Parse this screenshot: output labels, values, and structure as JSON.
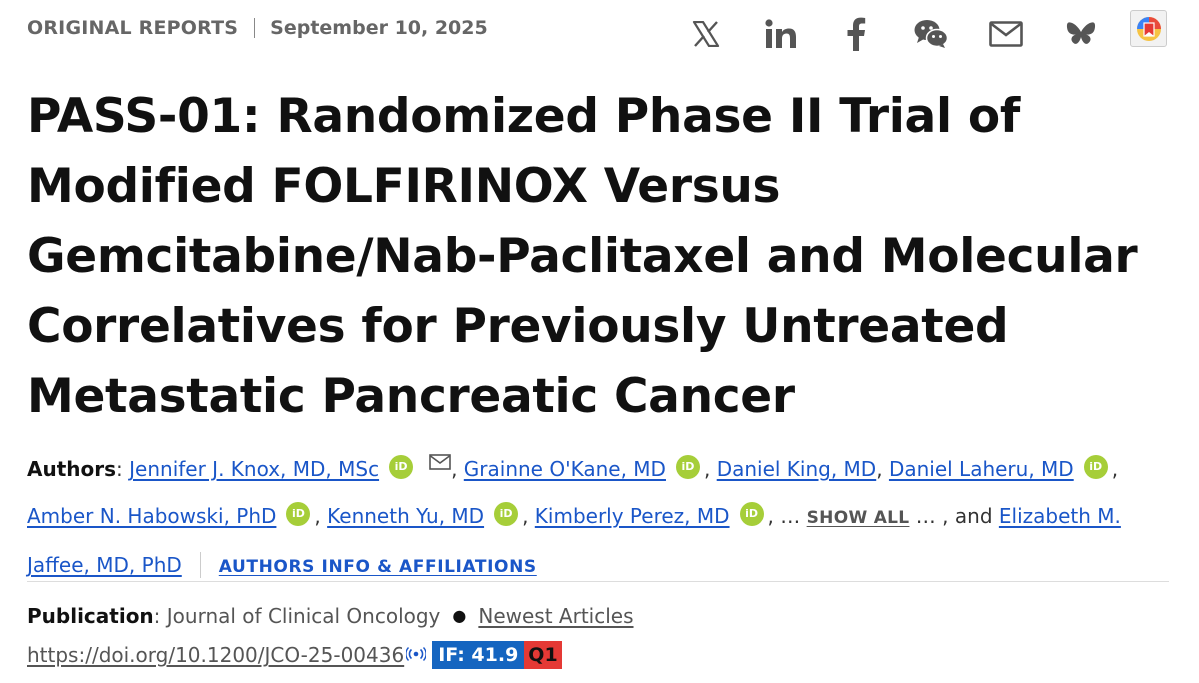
{
  "header": {
    "section": "ORIGINAL REPORTS",
    "date": "September 10, 2025"
  },
  "share": {
    "icons": [
      "x-icon",
      "linkedin-icon",
      "facebook-icon",
      "wechat-icon",
      "email-icon",
      "bluesky-icon"
    ]
  },
  "article": {
    "title": "PASS-01: Randomized Phase II Trial of Modified FOLFIRINOX Versus Gemcitabine/Nab-Paclitaxel and Molecular Correlatives for Previously Untreated Metastatic Pancreatic Cancer"
  },
  "authors": {
    "label": "Authors",
    "list": [
      "Jennifer J. Knox, MD, MSc",
      "Grainne O'Kane, MD",
      "Daniel King, MD",
      "Daniel Laheru, MD",
      "Amber N. Habowski, PhD",
      "Kenneth Yu, MD",
      "Kimberly Perez, MD",
      "Elizabeth M. Jaffee, MD, PhD"
    ],
    "show_all": "SHOW ALL",
    "and_text": ", and",
    "affiliations": "AUTHORS INFO & AFFILIATIONS",
    "orcid_text": "iD"
  },
  "publication": {
    "label": "Publication",
    "journal": "Journal of Clinical Oncology",
    "collection": "Newest Articles",
    "doi": "https://doi.org/10.1200/JCO-25-00436",
    "impact_factor": "IF: 41.9",
    "quartile": "Q1"
  },
  "colors": {
    "link": "#1a56c8",
    "orcid": "#a6ce39",
    "if_badge": "#1565c0",
    "q_badge": "#e53935"
  }
}
